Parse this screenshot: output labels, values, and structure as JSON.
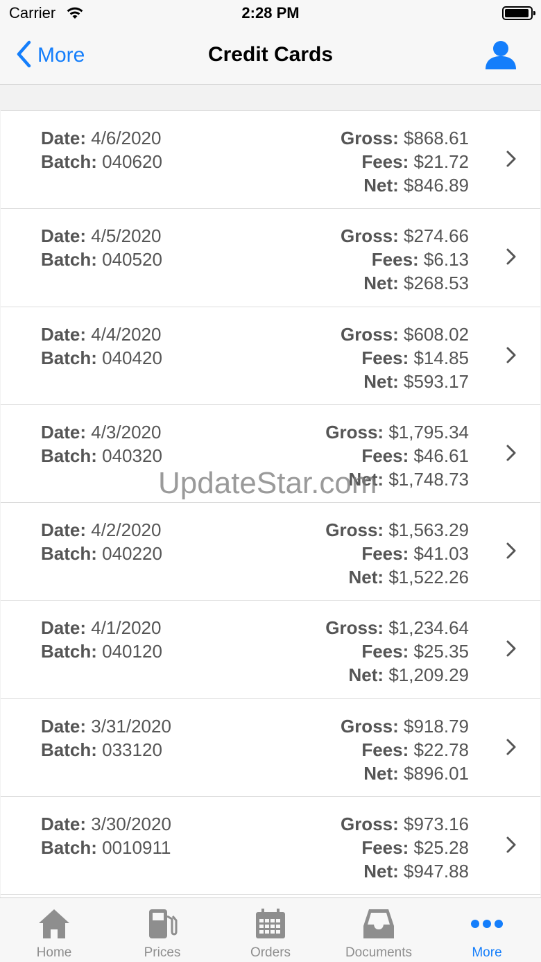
{
  "status": {
    "carrier": "Carrier",
    "time": "2:28 PM"
  },
  "nav": {
    "back_label": "More",
    "title": "Credit Cards"
  },
  "labels": {
    "date": "Date:",
    "batch": "Batch:",
    "gross": "Gross:",
    "fees": "Fees:",
    "net": "Net:"
  },
  "rows": [
    {
      "date": "4/6/2020",
      "batch": "040620",
      "gross": "$868.61",
      "fees": "$21.72",
      "net": "$846.89"
    },
    {
      "date": "4/5/2020",
      "batch": "040520",
      "gross": "$274.66",
      "fees": "$6.13",
      "net": "$268.53"
    },
    {
      "date": "4/4/2020",
      "batch": "040420",
      "gross": "$608.02",
      "fees": "$14.85",
      "net": "$593.17"
    },
    {
      "date": "4/3/2020",
      "batch": "040320",
      "gross": "$1,795.34",
      "fees": "$46.61",
      "net": "$1,748.73"
    },
    {
      "date": "4/2/2020",
      "batch": "040220",
      "gross": "$1,563.29",
      "fees": "$41.03",
      "net": "$1,522.26"
    },
    {
      "date": "4/1/2020",
      "batch": "040120",
      "gross": "$1,234.64",
      "fees": "$25.35",
      "net": "$1,209.29"
    },
    {
      "date": "3/31/2020",
      "batch": "033120",
      "gross": "$918.79",
      "fees": "$22.78",
      "net": "$896.01"
    },
    {
      "date": "3/30/2020",
      "batch": "0010911",
      "gross": "$973.16",
      "fees": "$25.28",
      "net": "$947.88"
    }
  ],
  "watermark": "UpdateStar.com",
  "tabs": [
    {
      "label": "Home",
      "icon": "home-icon"
    },
    {
      "label": "Prices",
      "icon": "fuel-pump-icon"
    },
    {
      "label": "Orders",
      "icon": "calendar-icon"
    },
    {
      "label": "Documents",
      "icon": "inbox-tray-icon"
    },
    {
      "label": "More",
      "icon": "more-dots-icon",
      "active": true
    }
  ],
  "colors": {
    "accent": "#147efb",
    "text": "#555555",
    "tab_inactive": "#8e8e8e"
  }
}
